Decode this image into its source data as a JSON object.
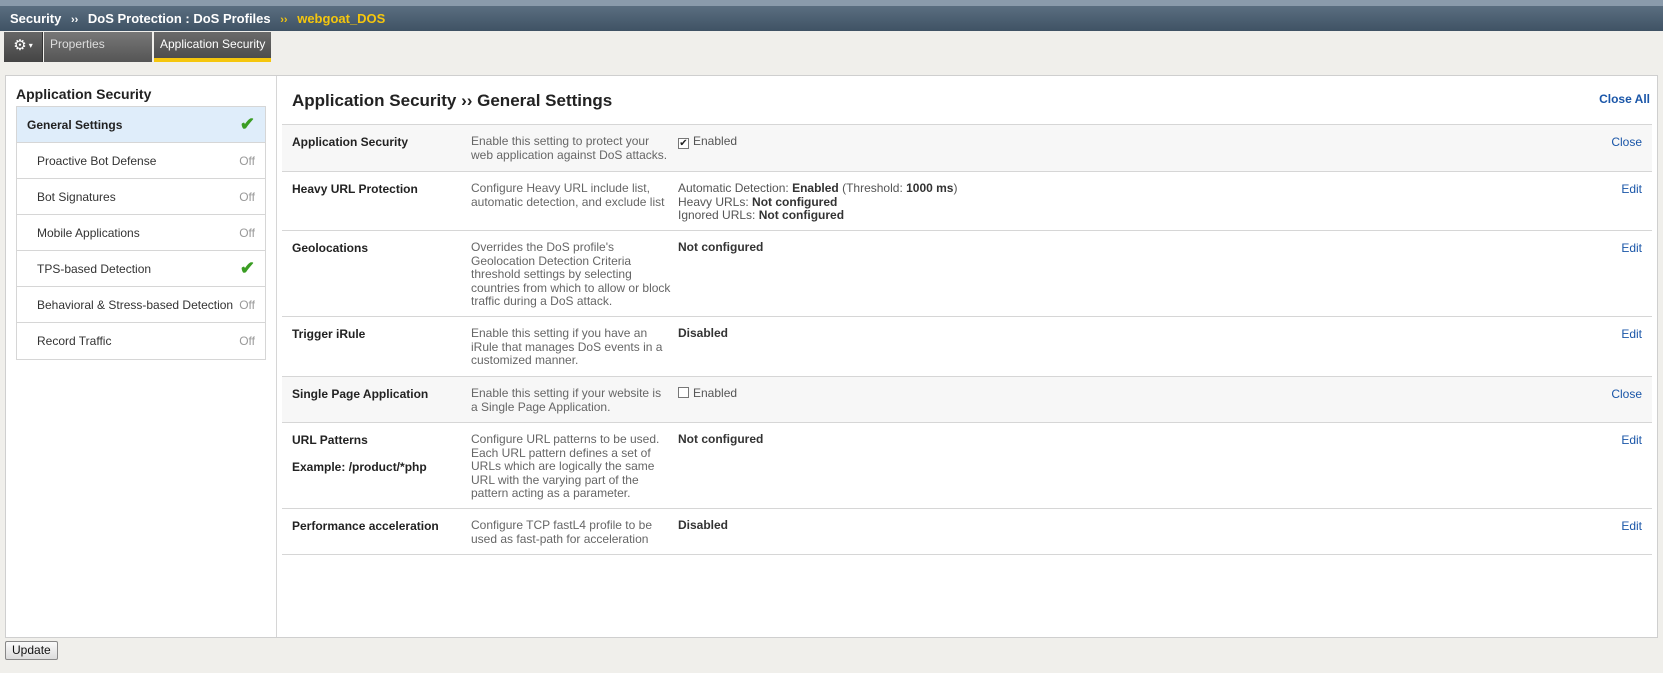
{
  "breadcrumb": {
    "section": "Security",
    "sep1": "››",
    "path": "DoS Protection : DoS Profiles",
    "sep2": "››",
    "current": "webgoat_DOS"
  },
  "tabs": {
    "gear_icon": "⚙",
    "caret": "▾",
    "properties": "Properties",
    "application_security": "Application Security"
  },
  "sidebar": {
    "title": "Application Security",
    "items": [
      {
        "label": "General Settings",
        "status": "✔"
      },
      {
        "label": "Proactive Bot Defense",
        "status": "Off"
      },
      {
        "label": "Bot Signatures",
        "status": "Off"
      },
      {
        "label": "Mobile Applications",
        "status": "Off"
      },
      {
        "label": "TPS-based Detection",
        "status": "✔"
      },
      {
        "label": "Behavioral & Stress-based Detection",
        "status": "Off"
      },
      {
        "label": "Record Traffic",
        "status": "Off"
      }
    ]
  },
  "main": {
    "title": "Application Security ›› General Settings",
    "close_all": "Close All",
    "rows": [
      {
        "name": "Application Security",
        "desc": "Enable this setting to protect your web application against DoS attacks.",
        "checkbox_checked": "✔",
        "value_label": "Enabled",
        "action": "Close"
      },
      {
        "name": "Heavy URL Protection",
        "desc": "Configure Heavy URL include list, automatic detection, and exclude list",
        "line1_a": "Automatic Detection: ",
        "line1_b": "Enabled",
        "line1_c": " (Threshold: ",
        "line1_d": "1000 ms",
        "line1_e": ")",
        "line2_a": "Heavy URLs: ",
        "line2_b": "Not configured",
        "line3_a": "Ignored URLs: ",
        "line3_b": "Not configured",
        "action": "Edit"
      },
      {
        "name": "Geolocations",
        "desc": "Overrides the DoS profile's Geolocation Detection Criteria threshold settings by selecting countries from which to allow or block traffic during a DoS attack.",
        "value": "Not configured",
        "action": "Edit"
      },
      {
        "name": "Trigger iRule",
        "desc": "Enable this setting if you have an iRule that manages DoS events in a customized manner.",
        "value": "Disabled",
        "action": "Edit"
      },
      {
        "name": "Single Page Application",
        "desc": "Enable this setting if your website is a Single Page Application.",
        "value_label": "Enabled",
        "action": "Close"
      },
      {
        "name": "URL Patterns",
        "example": "Example: /product/*php",
        "desc": "Configure URL patterns to be used. Each URL pattern defines a set of URLs which are logically the same URL with the varying part of the pattern acting as a parameter.",
        "value": "Not configured",
        "action": "Edit"
      },
      {
        "name": "Performance acceleration",
        "desc": "Configure TCP fastL4 profile to be used as fast-path for acceleration",
        "value": "Disabled",
        "action": "Edit"
      }
    ]
  },
  "update_button": "Update"
}
